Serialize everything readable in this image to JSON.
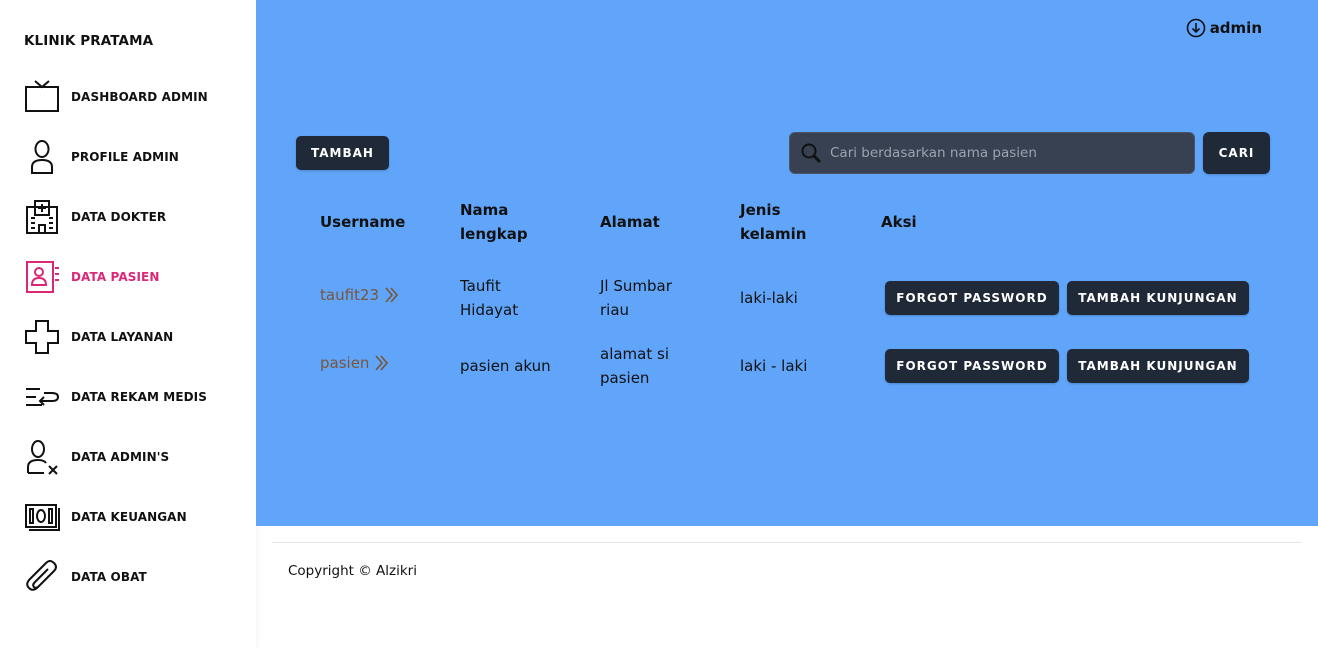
{
  "sidebar": {
    "brand": "KLINIK PRATAMA",
    "items": [
      {
        "label": "DASHBOARD ADMIN",
        "icon": "tv-icon"
      },
      {
        "label": "PROFILE ADMIN",
        "icon": "user-icon"
      },
      {
        "label": "DATA DOKTER",
        "icon": "hospital-icon"
      },
      {
        "label": "DATA PASIEN",
        "icon": "patient-card-icon",
        "active": true
      },
      {
        "label": "DATA LAYANAN",
        "icon": "plus-cross-icon"
      },
      {
        "label": "DATA REKAM MEDIS",
        "icon": "records-icon"
      },
      {
        "label": "DATA ADMIN'S",
        "icon": "user-remove-icon"
      },
      {
        "label": "DATA KEUANGAN",
        "icon": "money-icon"
      },
      {
        "label": "DATA OBAT",
        "icon": "paperclip-icon"
      }
    ],
    "active_color": "#db2777"
  },
  "header": {
    "user": "admin",
    "user_icon": "arrow-down-circle-icon"
  },
  "toolbar": {
    "add_label": "TAMBAH",
    "search_placeholder": "Cari berdasarkan nama pasien",
    "search_value": "",
    "search_button": "CARI"
  },
  "table": {
    "headers": {
      "username": "Username",
      "nama_1": "Nama",
      "nama_2": "lengkap",
      "alamat": "Alamat",
      "jenis_1": "Jenis",
      "jenis_2": "kelamin",
      "aksi": "Aksi"
    },
    "rows": [
      {
        "username": "taufit23",
        "nama_1": "Taufit",
        "nama_2": "Hidayat",
        "alamat_1": "Jl Sumbar",
        "alamat_2": "riau",
        "jenis": "laki-laki",
        "forgot": "FORGOT PASSWORD",
        "tambah": "TAMBAH KUNJUNGAN"
      },
      {
        "username": "pasien",
        "nama_1": "pasien akun",
        "alamat_1": "alamat si",
        "alamat_2": "pasien",
        "jenis": "laki - laki",
        "forgot": "FORGOT PASSWORD",
        "tambah": "TAMBAH KUNJUNGAN"
      }
    ]
  },
  "footer": {
    "copyright": "Copyright © Alzikri"
  },
  "colors": {
    "main_bg": "#60a5fa",
    "button_dark": "#1f2937",
    "search_bg": "#374151",
    "link": "#78563a"
  }
}
